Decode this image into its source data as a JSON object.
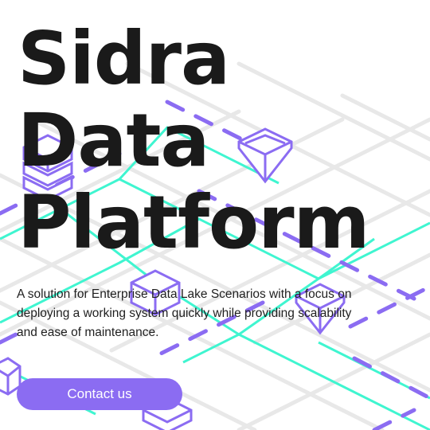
{
  "hero": {
    "title_lines": [
      "Sidra",
      "Data",
      "Platform"
    ],
    "description": "A solution for Enterprise Data Lake Scenarios with a focus on deploying a working system quickly while providing scalability and ease of maintenance.",
    "cta_label": "Contact us"
  },
  "colors": {
    "background": "#ffffff",
    "title": "#1a1a1a",
    "accent_purple": "#8b6cf2",
    "accent_teal": "#3ff5d0",
    "grid": "#e6e6e6"
  },
  "icons": [
    "database-stack-icon",
    "funnel-icon",
    "cube-icon"
  ]
}
